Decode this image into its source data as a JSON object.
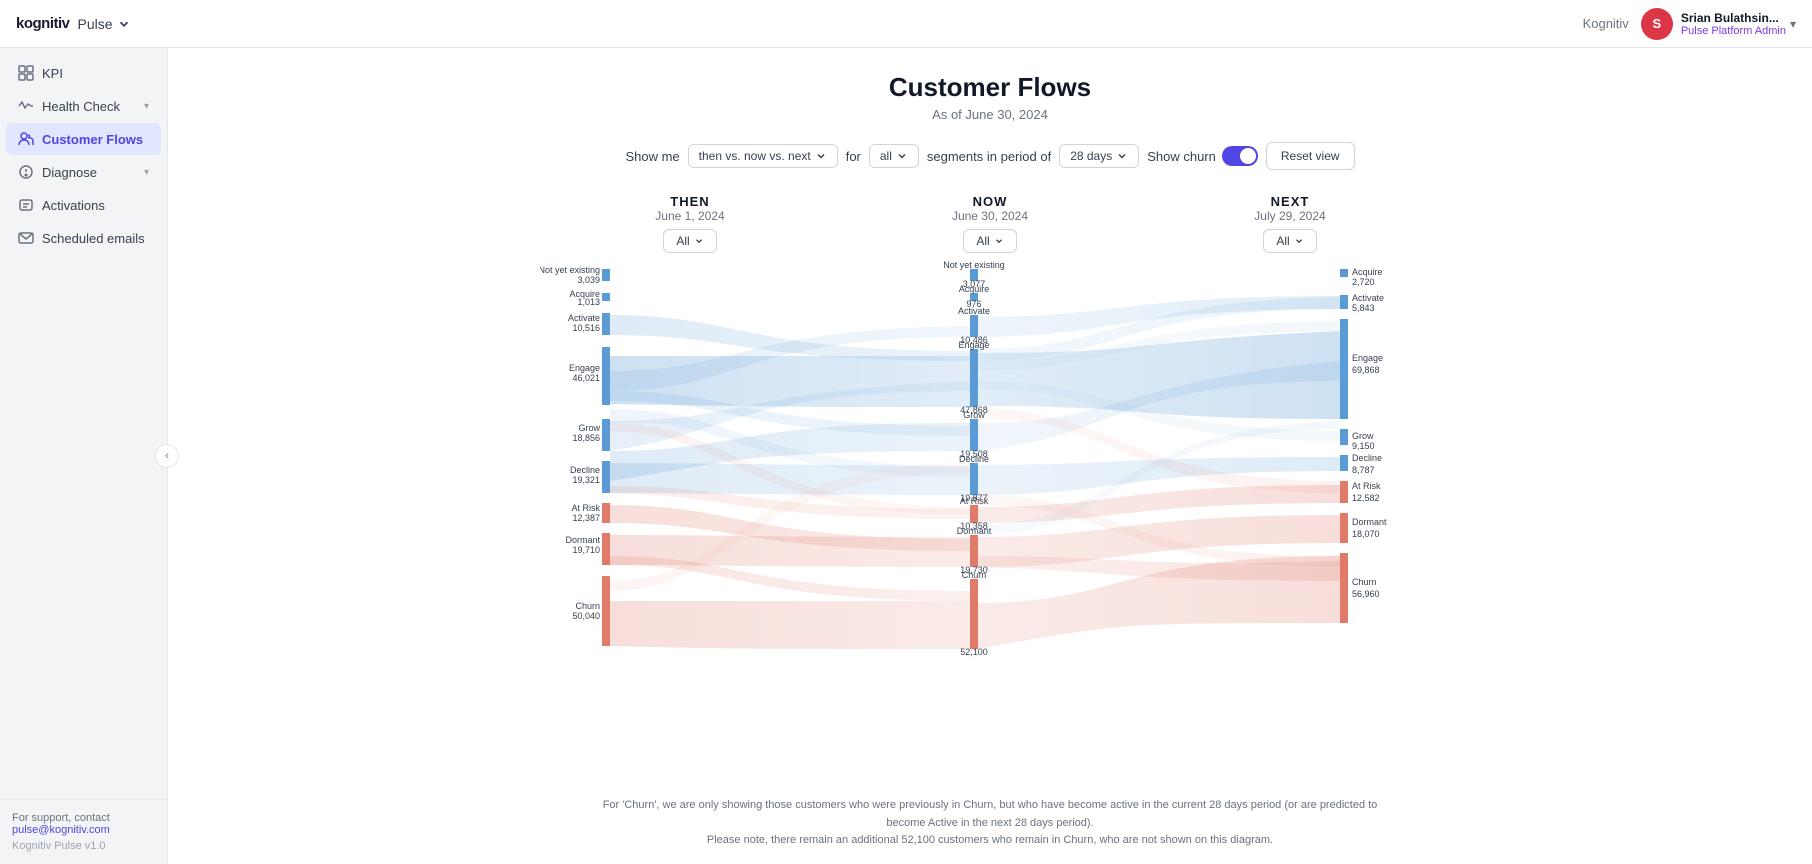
{
  "topnav": {
    "logo": "kognitiv",
    "app": "Pulse",
    "org": "Kognitiv",
    "username": "Srian Bulathsin...",
    "role": "Pulse Platform Admin",
    "avatar_initial": "S"
  },
  "sidebar": {
    "collapse_icon": "‹",
    "items": [
      {
        "id": "kpi",
        "label": "KPI",
        "icon": "grid",
        "active": false,
        "has_chevron": false
      },
      {
        "id": "health-check",
        "label": "Health Check",
        "icon": "activity",
        "active": false,
        "has_chevron": true
      },
      {
        "id": "customer-flows",
        "label": "Customer Flows",
        "icon": "users",
        "active": true,
        "has_chevron": false
      },
      {
        "id": "diagnose",
        "label": "Diagnose",
        "icon": "diagnose",
        "active": false,
        "has_chevron": true
      },
      {
        "id": "activations",
        "label": "Activations",
        "icon": "activations",
        "active": false,
        "has_chevron": false
      },
      {
        "id": "scheduled-emails",
        "label": "Scheduled emails",
        "icon": "email",
        "active": false,
        "has_chevron": false
      }
    ],
    "footer": {
      "support_text": "For support, contact",
      "email": "pulse@kognitiv.com",
      "version": "Kognitiv Pulse v1.0"
    }
  },
  "page": {
    "title": "Customer Flows",
    "subtitle": "As of June 30, 2024"
  },
  "controls": {
    "show_me_label": "Show me",
    "show_me_value": "then vs. now vs. next",
    "for_label": "for",
    "for_value": "all",
    "segments_label": "segments in period of",
    "period_value": "28 days",
    "show_churn_label": "Show churn",
    "reset_label": "Reset view"
  },
  "columns": [
    {
      "id": "then",
      "title": "THEN",
      "date": "June 1, 2024",
      "filter": "All"
    },
    {
      "id": "now",
      "title": "NOW",
      "date": "June 30, 2024",
      "filter": "All"
    },
    {
      "id": "next",
      "title": "NEXT",
      "date": "July 29, 2024",
      "filter": "All"
    }
  ],
  "nodes": {
    "then": [
      {
        "label": "Not yet existing",
        "value": "3,039"
      },
      {
        "label": "Acquire",
        "value": "1,013"
      },
      {
        "label": "Activate",
        "value": "10,516"
      },
      {
        "label": "Engage",
        "value": "46,021"
      },
      {
        "label": "Grow",
        "value": "18,856"
      },
      {
        "label": "Decline",
        "value": "19,321"
      },
      {
        "label": "At Risk",
        "value": "12,387"
      },
      {
        "label": "Dormant",
        "value": "19,710"
      },
      {
        "label": "Churn",
        "value": "50,040"
      }
    ],
    "now": [
      {
        "label": "Not yet existing",
        "value": "3,077"
      },
      {
        "label": "Acquire",
        "value": "976"
      },
      {
        "label": "Activate",
        "value": "10,486"
      },
      {
        "label": "Engage",
        "value": "47,868"
      },
      {
        "label": "Grow",
        "value": "19,508"
      },
      {
        "label": "Decline",
        "value": "19,877"
      },
      {
        "label": "At Risk",
        "value": "10,358"
      },
      {
        "label": "Dormant",
        "value": "19,730"
      },
      {
        "label": "Churn",
        "value": "52,100"
      }
    ],
    "next": [
      {
        "label": "Acquire",
        "value": "2,720"
      },
      {
        "label": "Activate",
        "value": "5,843"
      },
      {
        "label": "Engage",
        "value": "69,868"
      },
      {
        "label": "Grow",
        "value": "9,150"
      },
      {
        "label": "Decline",
        "value": "8,787"
      },
      {
        "label": "At Risk",
        "value": "12,582"
      },
      {
        "label": "Dormant",
        "value": "18,070"
      },
      {
        "label": "Churn",
        "value": "56,960"
      }
    ]
  },
  "footer_notes": [
    "For 'Churn', we are only showing those customers who were previously in Churn, but who have become active in the current 28 days period (or are predicted to become Active in the next 28 days period).",
    "Please note, there remain an additional 52,100 customers who remain in Churn, who are not shown on this diagram."
  ]
}
